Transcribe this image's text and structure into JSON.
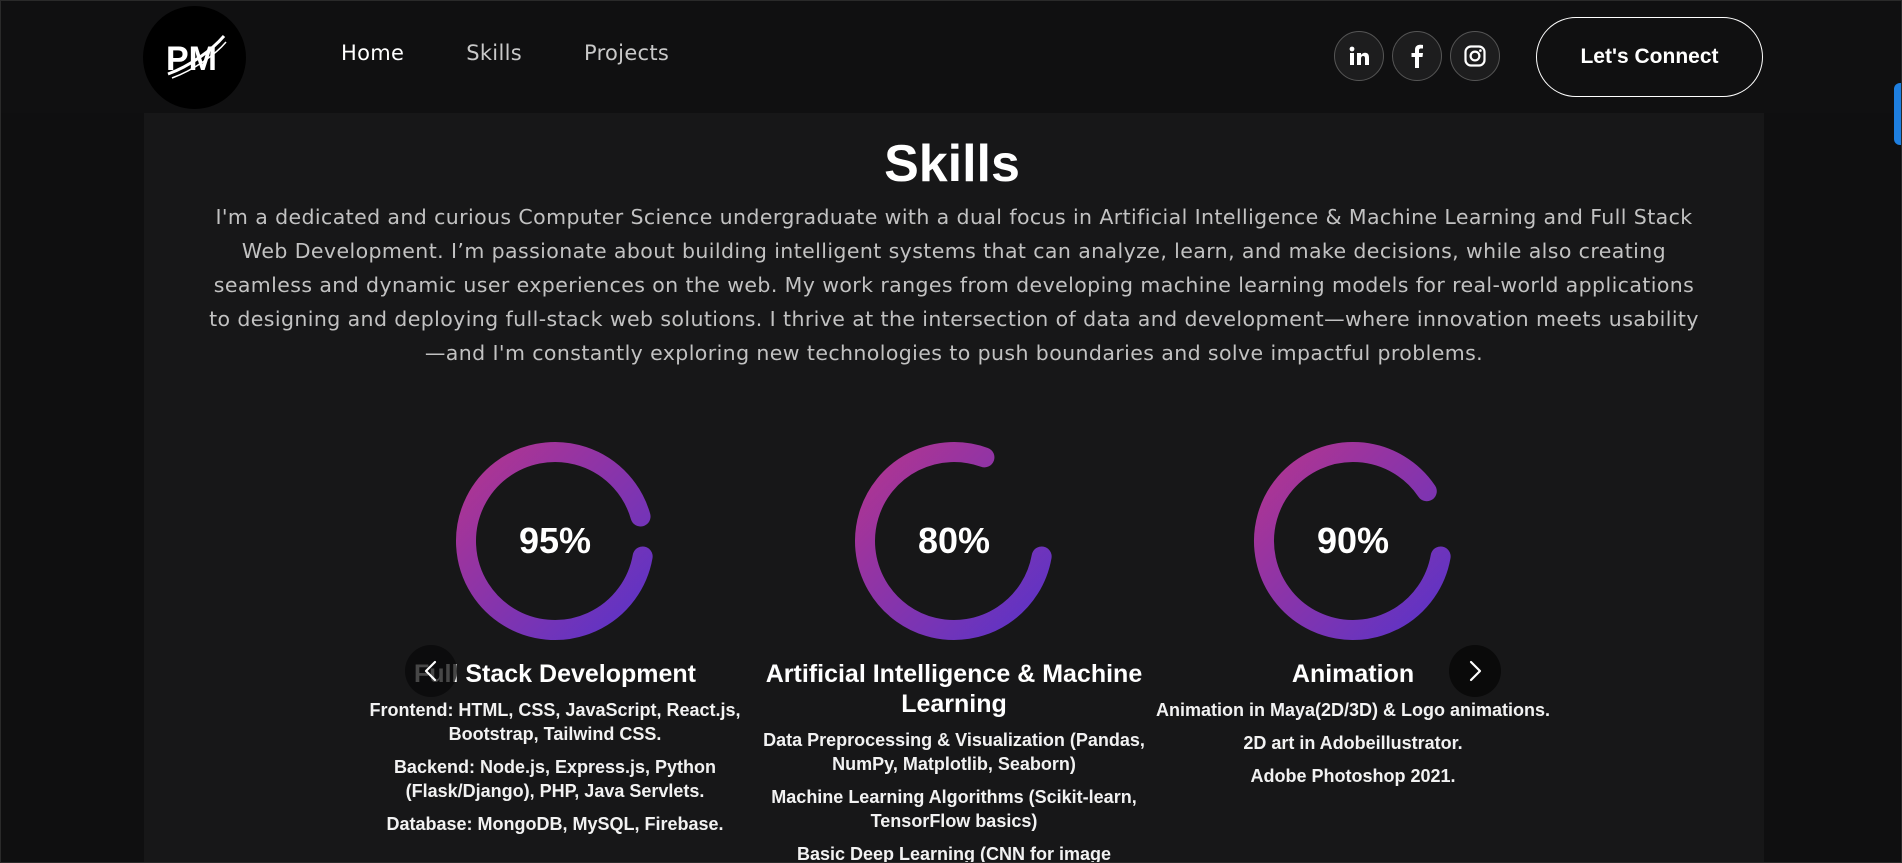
{
  "brand": {
    "logo_text": "PM"
  },
  "nav": {
    "links": [
      {
        "label": "Home",
        "active": true
      },
      {
        "label": "Skills",
        "active": false
      },
      {
        "label": "Projects",
        "active": false
      }
    ],
    "socials": [
      "linkedin-icon",
      "facebook-icon",
      "instagram-icon"
    ],
    "cta_label": "Let's Connect"
  },
  "skills": {
    "title": "Skills",
    "intro": "I'm a dedicated and curious Computer Science undergraduate with a dual focus in Artificial Intelligence & Machine Learning and Full Stack Web Development. I’m passionate about building intelligent systems that can analyze, learn, and make decisions, while also creating seamless and dynamic user experiences on the web. My work ranges from developing machine learning models for real-world applications to designing and deploying full-stack web solutions. I thrive at the intersection of data and development—where innovation meets usability—and I'm constantly exploring new technologies to push boundaries and solve impactful problems.",
    "cards": [
      {
        "percent_label": "95%",
        "percent": 95,
        "title": "Full Stack Development",
        "lines": [
          "Frontend: HTML, CSS, JavaScript, React.js, Bootstrap, Tailwind CSS.",
          "Backend: Node.js, Express.js, Python (Flask/Django), PHP, Java Servlets.",
          "Database: MongoDB, MySQL, Firebase."
        ]
      },
      {
        "percent_label": "80%",
        "percent": 80,
        "title": "Artificial Intelligence & Machine Learning",
        "lines": [
          "Data Preprocessing & Visualization (Pandas, NumPy, Matplotlib, Seaborn)",
          "Machine Learning Algorithms (Scikit-learn, TensorFlow basics)",
          "Basic Deep Learning (CNN for image"
        ]
      },
      {
        "percent_label": "90%",
        "percent": 90,
        "title": "Animation",
        "lines": [
          "Animation in Maya(2D/3D) & Logo animations.",
          "2D art in Adobeillustrator.",
          "Adobe Photoshop 2021."
        ]
      }
    ]
  },
  "colors": {
    "ring_start": "#b3358f",
    "ring_end": "#5a33c8",
    "scroll_accent": "#1e7fe0"
  }
}
